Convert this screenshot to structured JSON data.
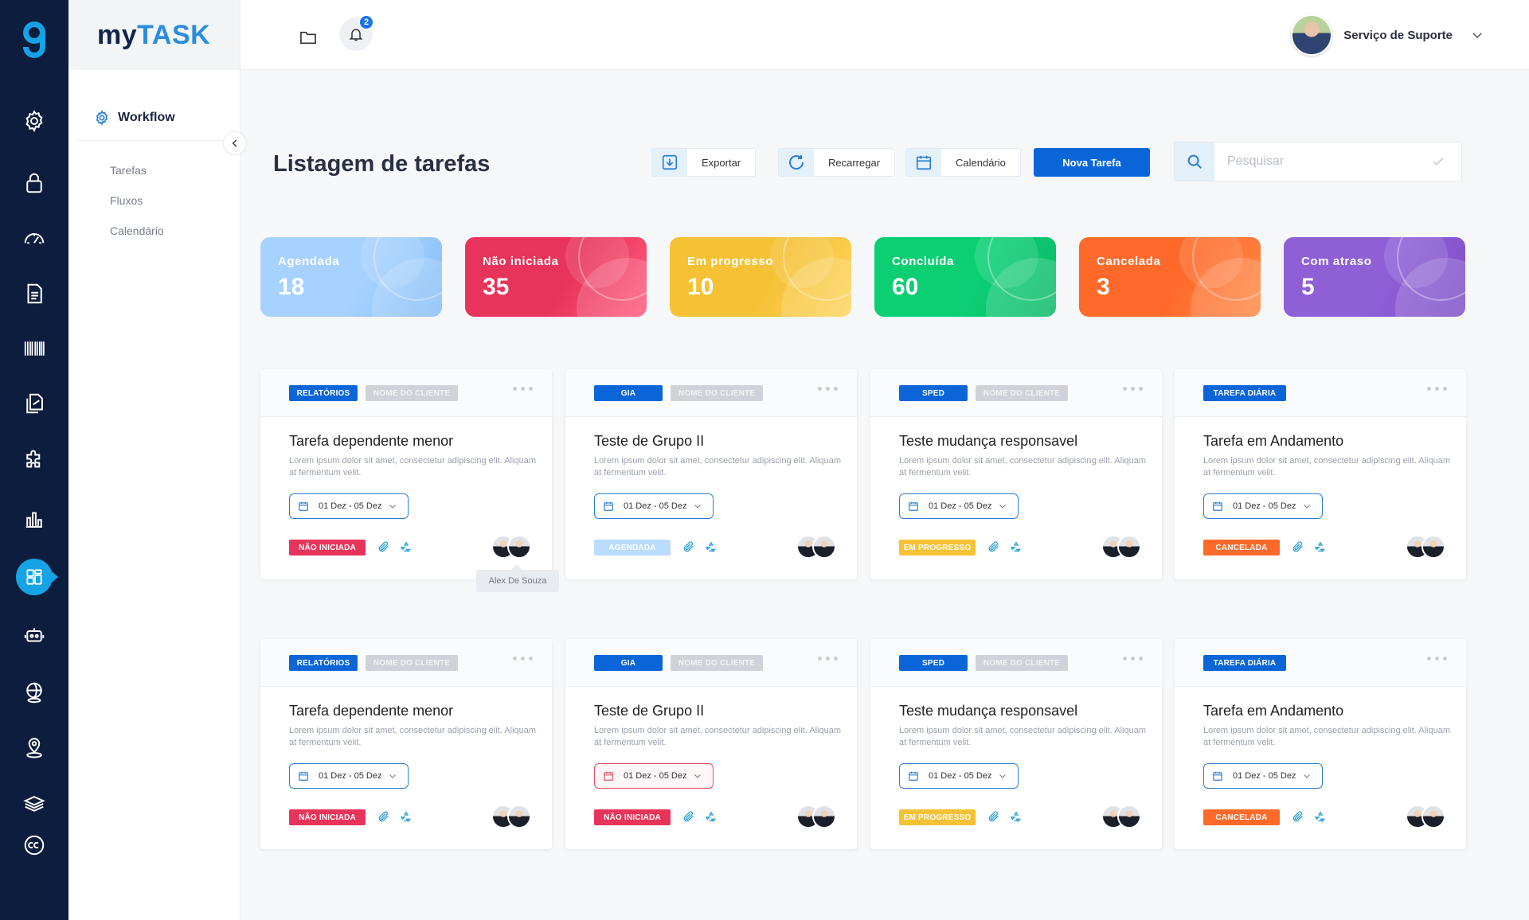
{
  "brand": {
    "prefix": "my",
    "name": "TASK",
    "logo_letter": "g"
  },
  "colors": {
    "rail": "#0c1d3d",
    "primary": "#0a66d8",
    "accent": "#16a3e6"
  },
  "rail_icons": [
    "gear-icon",
    "lock-icon",
    "speedometer-icon",
    "document-icon",
    "barcode-icon",
    "documents-icon",
    "puzzle-icon",
    "bar-chart-icon",
    "dashboard-grid-icon",
    "robot-icon",
    "globe-coins-icon",
    "location-icon",
    "money-stack-icon",
    "cc-icon"
  ],
  "sidebar": {
    "section": "Workflow",
    "items": [
      "Tarefas",
      "Fluxos",
      "Calendário"
    ]
  },
  "topbar": {
    "notifications": "2",
    "user_name": "Serviço de Suporte"
  },
  "main": {
    "title": "Listagem de tarefas",
    "export_label": "Exportar",
    "reload_label": "Recarregar",
    "calendar_label": "Calendário",
    "new_task_label": "Nova Tarefa",
    "search_placeholder": "Pesquisar"
  },
  "stats": [
    {
      "label": "Agendada",
      "value": "18",
      "color": "#a7d2ff",
      "color2": "#86bdf7"
    },
    {
      "label": "Não iniciada",
      "value": "35",
      "color": "#e8345a",
      "color2": "#ff5a7c"
    },
    {
      "label": "Em progresso",
      "value": "10",
      "color": "#f5c236",
      "color2": "#ffd45e"
    },
    {
      "label": "Concluída",
      "value": "60",
      "color": "#0ccf74",
      "color2": "#0bb866"
    },
    {
      "label": "Cancelada",
      "value": "3",
      "color": "#ff6a2a",
      "color2": "#ff8a48"
    },
    {
      "label": "Com atraso",
      "value": "5",
      "color": "#8f5fd6",
      "color2": "#7d4fc6"
    }
  ],
  "cards": [
    {
      "category": "RELATÓRIOS",
      "client": "NOME DO CLIENTE",
      "title": "Tarefa dependente menor",
      "desc": "Lorem ipsum dolor sit amet, consectetur adipiscing elit. Aliquam at fermentum velit.",
      "date": "01 Dez - 05 Dez",
      "status": "NÃO INICIADA",
      "status_color": "#e8345a"
    },
    {
      "category": "GIA",
      "client": "NOME DO CLIENTE",
      "title": "Teste de Grupo II",
      "desc": "Lorem ipsum dolor sit amet, consectetur adipiscing elit. Aliquam at fermentum velit.",
      "date": "01 Dez - 05 Dez",
      "status": "AGENDADA",
      "status_color": "#b9dcff"
    },
    {
      "category": "SPED",
      "client": "NOME DO CLIENTE",
      "title": "Teste mudança responsavel",
      "desc": "Lorem ipsum dolor sit amet, consectetur adipiscing elit. Aliquam at fermentum velit.",
      "date": "01 Dez - 05 Dez",
      "status": "EM PROGRESSO",
      "status_color": "#f5c236"
    },
    {
      "category": "TAREFA DIÁRIA",
      "client": "",
      "title": "Tarefa em Andamento",
      "desc": "Lorem ipsum dolor sit amet, consectetur adipiscing elit. Aliquam at fermentum velit.",
      "date": "01 Dez - 05 Dez",
      "status": "CANCELADA",
      "status_color": "#ff6a2a"
    },
    {
      "category": "RELATÓRIOS",
      "client": "NOME DO CLIENTE",
      "title": "Tarefa dependente menor",
      "desc": "Lorem ipsum dolor sit amet, consectetur adipiscing elit. Aliquam at fermentum velit.",
      "date": "01 Dez - 05 Dez",
      "status": "NÃO INICIADA",
      "status_color": "#e8345a"
    },
    {
      "category": "GIA",
      "client": "NOME DO CLIENTE",
      "title": "Teste de Grupo II",
      "desc": "Lorem ipsum dolor sit amet, consectetur adipiscing elit. Aliquam at fermentum velit.",
      "date": "01 Dez - 05 Dez",
      "status": "NÃO INICIADA",
      "status_color": "#e8345a",
      "date_alert": true
    },
    {
      "category": "SPED",
      "client": "NOME DO CLIENTE",
      "title": "Teste mudança responsavel",
      "desc": "Lorem ipsum dolor sit amet, consectetur adipiscing elit. Aliquam at fermentum velit.",
      "date": "01 Dez - 05 Dez",
      "status": "EM PROGRESSO",
      "status_color": "#f5c236"
    },
    {
      "category": "TAREFA DIÁRIA",
      "client": "",
      "title": "Tarefa em Andamento",
      "desc": "Lorem ipsum dolor sit amet, consectetur adipiscing elit. Aliquam at fermentum velit.",
      "date": "01 Dez - 05 Dez",
      "status": "CANCELADA",
      "status_color": "#ff6a2a"
    }
  ],
  "tooltip": "Alex De Souza"
}
